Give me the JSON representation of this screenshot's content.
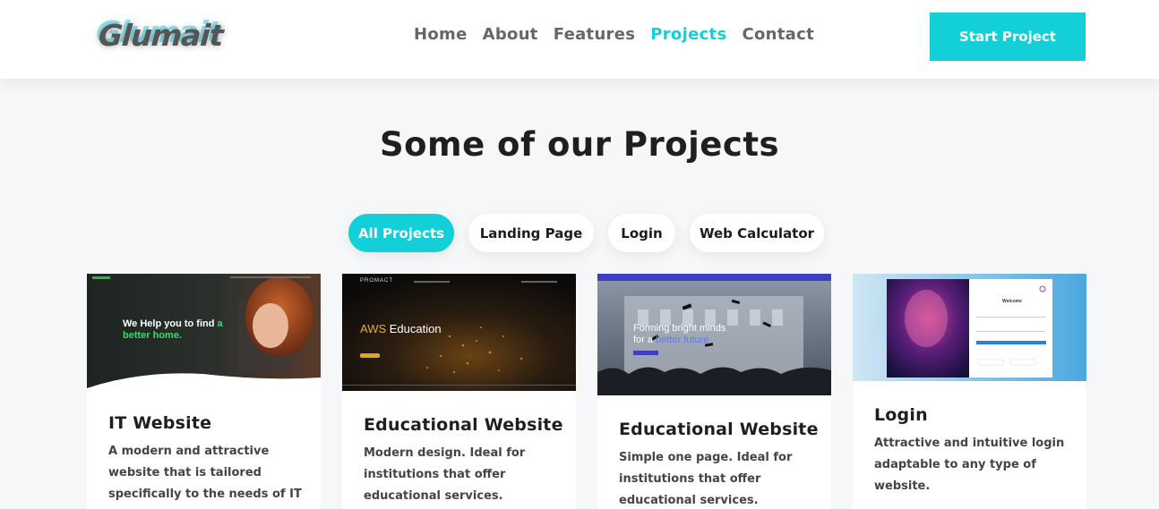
{
  "header": {
    "logo": "Glumait",
    "nav": [
      "Home",
      "About",
      "Features",
      "Projects",
      "Contact"
    ],
    "active_nav": "Projects",
    "cta_label": "Start Project"
  },
  "section": {
    "title": "Some of our Projects"
  },
  "filters": [
    "All Projects",
    "Landing Page",
    "Login",
    "Web Calculator"
  ],
  "colors": {
    "accent": "#12cfd8",
    "background": "#f6f7f9"
  },
  "projects": [
    {
      "title": "IT Website",
      "description": "A modern and attractive website that is tailored specifically to the needs of IT",
      "thumb": {
        "headline_a": "We Help you to find",
        "headline_accent": "a",
        "headline_b": "better home."
      }
    },
    {
      "title": "Educational Website",
      "description": "Modern design. Ideal for institutions that offer educational services.",
      "thumb": {
        "brand": "PROMACT",
        "headline_accent": "AWS",
        "headline": "Education"
      }
    },
    {
      "title": "Educational Website",
      "description": "Simple one page. Ideal for institutions that offer educational services.",
      "thumb": {
        "headline_a": "Forming bright minds",
        "headline_b": "for a",
        "headline_accent": "better future"
      }
    },
    {
      "title": "Login",
      "description": "Attractive and intuitive login adaptable to any type of website.",
      "thumb": {
        "welcome": "Welcome"
      }
    }
  ]
}
